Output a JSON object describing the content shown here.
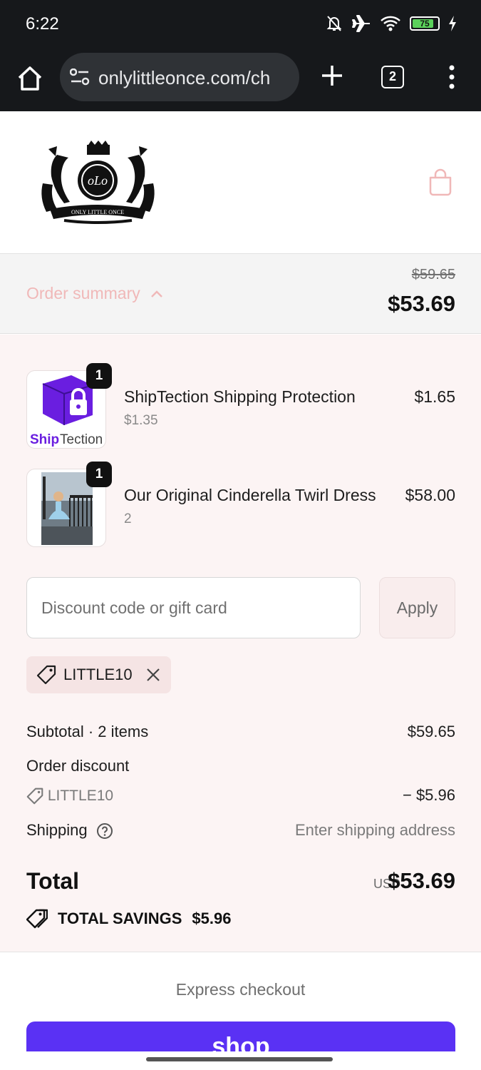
{
  "status_bar": {
    "time": "6:22",
    "battery": "75",
    "icons": [
      "mute-icon",
      "airplane-icon",
      "wifi-icon",
      "battery-icon",
      "charging-icon"
    ]
  },
  "browser": {
    "url": "onlylittleonce.com/ch",
    "tab_count": "2"
  },
  "header": {
    "logo_text": "ONLY LITTLE ONCE",
    "cart_icon": "shopping-bag-icon"
  },
  "summary_bar": {
    "label": "Order summary",
    "original_total": "$59.65",
    "total": "$53.69"
  },
  "line_items": [
    {
      "name": "ShipTection Shipping Protection",
      "sub": "$1.35",
      "price": "$1.65",
      "quantity": "1",
      "thumb_text_bold": "Ship",
      "thumb_text": "Tection"
    },
    {
      "name": "Our Original Cinderella Twirl Dress",
      "sub": "2",
      "price": "$58.00",
      "quantity": "1"
    }
  ],
  "discount": {
    "placeholder": "Discount code or gift card",
    "apply_label": "Apply",
    "applied_code": "LITTLE10"
  },
  "totals": {
    "subtotal_label": "Subtotal · 2 items",
    "subtotal_value": "$59.65",
    "order_discount_label": "Order discount",
    "discount_code": "LITTLE10",
    "discount_value": "− $5.96",
    "shipping_label": "Shipping",
    "shipping_value": "Enter shipping address",
    "total_label": "Total",
    "currency": "USD",
    "total_value": "$53.69",
    "savings_label": "TOTAL SAVINGS",
    "savings_value": "$5.96"
  },
  "express": {
    "label": "Express checkout",
    "shop_pay_label": "shop"
  },
  "colors": {
    "accent_purple": "#5a31f4",
    "summary_link": "#f0b8b8",
    "panel_bg": "#fcf4f4"
  }
}
